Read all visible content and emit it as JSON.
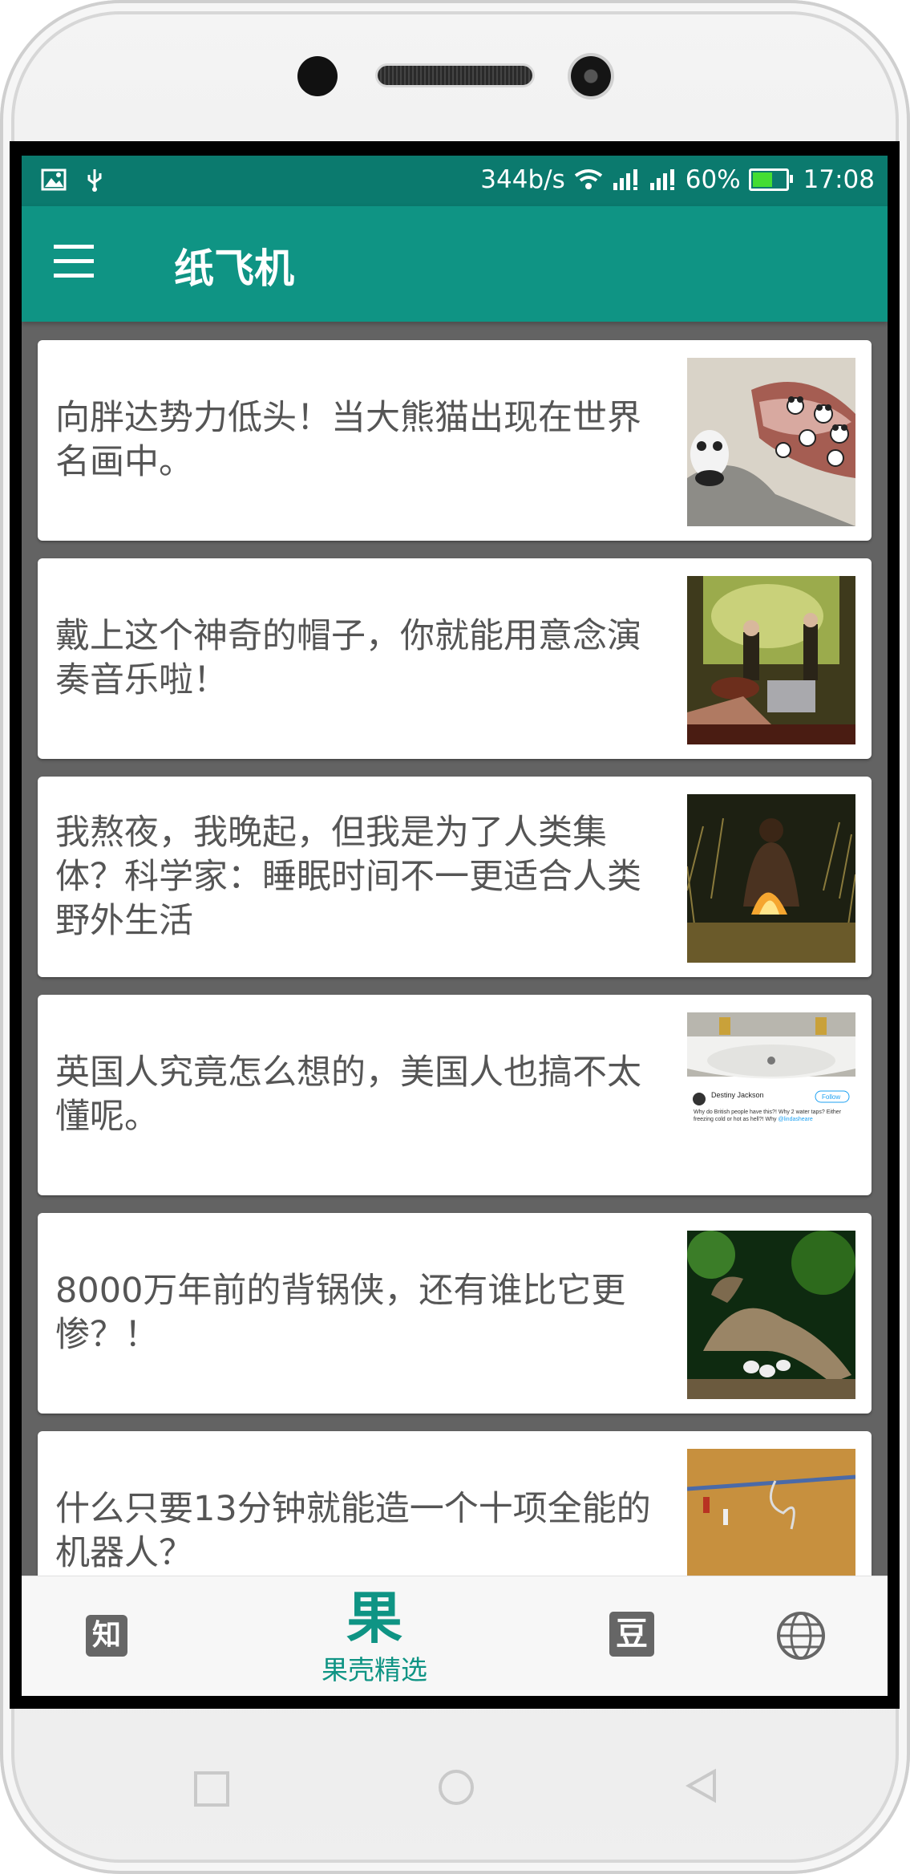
{
  "status_bar": {
    "speed": "344b/s",
    "battery": "60%",
    "battery_level": 0.6,
    "time": "17:08",
    "icons": [
      "image-icon",
      "usb-icon",
      "wifi-icon",
      "signal-icon",
      "signal-icon",
      "battery-icon"
    ]
  },
  "app_bar": {
    "title": "纸飞机",
    "menu_icon": "menu-icon"
  },
  "feed": {
    "items": [
      {
        "title": "向胖达势力低头！当大熊猫出现在世界名画中。",
        "thumb": "panda-painting-image"
      },
      {
        "title": "戴上这个神奇的帽子，你就能用意念演奏音乐啦！",
        "thumb": "band-concert-image"
      },
      {
        "title": "我熬夜，我晚起，但我是为了人类集体？科学家：睡眠时间不一更适合人类野外生活",
        "thumb": "campfire-image"
      },
      {
        "title": "英国人究竟怎么想的，美国人也搞不太懂呢。",
        "thumb": "sink-tweet-image"
      },
      {
        "title": "8000万年前的背锅侠，还有谁比它更惨？！",
        "thumb": "dinosaur-image"
      },
      {
        "title": "什么只要13分钟就能造一个十项全能的机器人？",
        "thumb": "robot-wire-image"
      }
    ]
  },
  "tweet_thumb": {
    "name": "Destiny Jackson",
    "follow": "Follow",
    "text": "Why do British people have this?! Why 2 water taps? Either freezing cold or hot as hell?! Why",
    "mention": "@lindasheare"
  },
  "bottom_nav": {
    "zhi_icon": "知",
    "guo_icon": "果",
    "guo_label": "果壳精选",
    "dou_icon": "豆",
    "globe_icon": "globe-icon"
  },
  "colors": {
    "status_bar": "#0b7a6e",
    "app_bar": "#0f9484",
    "accent": "#0f9484",
    "feed_bg": "#636363"
  }
}
